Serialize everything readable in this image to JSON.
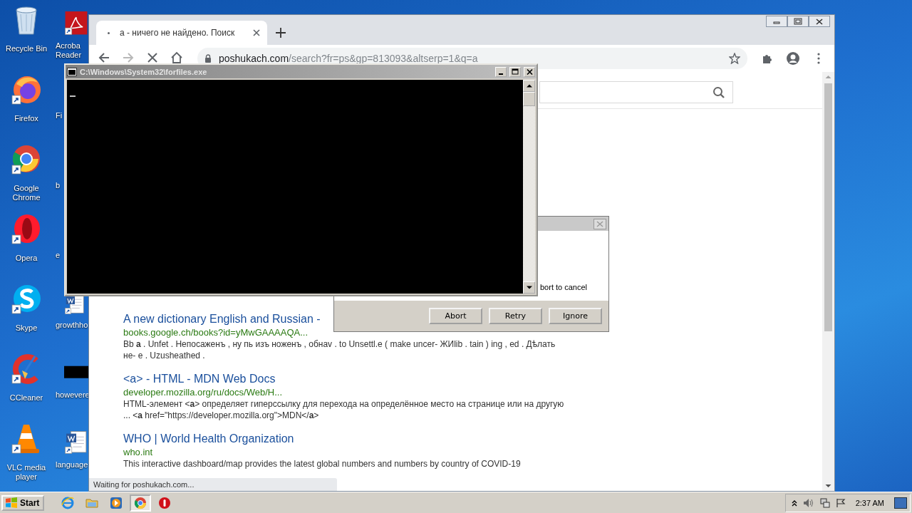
{
  "desktop": {
    "icons": [
      {
        "label": "Recycle Bin",
        "kind": "trash"
      },
      {
        "label": "Acroba Reader",
        "kind": "pdf"
      },
      {
        "label": "Firefox",
        "kind": "firefox"
      },
      {
        "label": "Fi"
      },
      {
        "label": "Google Chrome",
        "kind": "chrome"
      },
      {
        "label": "b"
      },
      {
        "label": "Opera",
        "kind": "opera"
      },
      {
        "label": "e"
      },
      {
        "label": "Skype",
        "kind": "skype"
      },
      {
        "label": "growthho",
        "kind": "word"
      },
      {
        "label": "CCleaner",
        "kind": "ccleaner"
      },
      {
        "label": "howevere",
        "kind": "dark"
      },
      {
        "label": "VLC media player",
        "kind": "vlc"
      },
      {
        "label": "language",
        "kind": "word"
      }
    ]
  },
  "browser": {
    "tab": {
      "title": "а - ничего не найдено. Поиск",
      "selected": true
    },
    "nav": [
      {
        "kind": "back",
        "disabled": false
      },
      {
        "kind": "forward",
        "disabled": true
      },
      {
        "kind": "stop",
        "disabled": false
      },
      {
        "kind": "home",
        "disabled": false
      }
    ],
    "url": {
      "host": "poshukach.com",
      "path": "/search?fr=ps&gp=813093&altserp=1&q=a"
    },
    "results": [
      {
        "title": "A new dictionary English and Russian -",
        "url": "books.google.ch/books?id=yMwGAAAAQA...",
        "snippet": "Bb **a** . Unfet . Непосаженъ , ну пь изъ ноженъ , обнаv . to Unsettl.e ( make uncer- ЖИlib . tain ) ing , ed . Дѣлать не- е . Uzusheathed ."
      },
      {
        "title": "<a> - HTML - MDN Web Docs",
        "url": "developer.mozilla.org/ru/docs/Web/H...",
        "snippet": "HTML-элемент <**a**> определяет гиперссылку для перехода на определённое место на странице или на другую ... <**a** href=\"https://developer.mozilla.org\">MDN</**a**>"
      },
      {
        "title": "WHO | World Health Organization",
        "url": "who.int",
        "snippet": "This interactive dashboard/map provides the latest global numbers and numbers by country of COVID-19"
      }
    ],
    "status": "Waiting for poshukach.com..."
  },
  "console": {
    "title": "C:\\Windows\\System32\\forfiles.exe"
  },
  "dialog": {
    "text": "bort to cancel",
    "buttons": [
      "Abort",
      "Retry",
      "Ignore"
    ]
  },
  "taskbar": {
    "start": "Start",
    "apps": [
      {
        "kind": "ie",
        "selected": false
      },
      {
        "kind": "folder",
        "selected": false
      },
      {
        "kind": "media",
        "selected": false
      },
      {
        "kind": "chrome",
        "selected": true
      },
      {
        "kind": "alert",
        "selected": false
      }
    ],
    "clock": "2:37 AM"
  }
}
